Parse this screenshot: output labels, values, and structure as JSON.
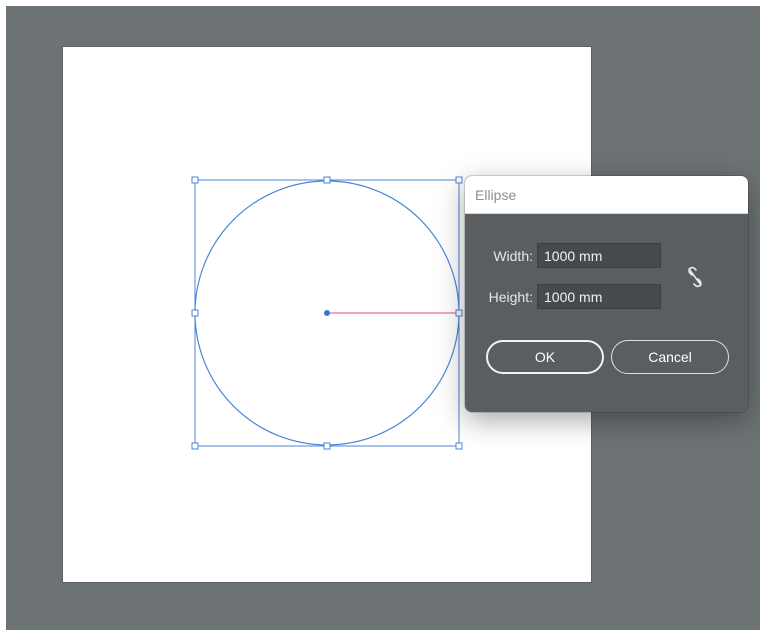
{
  "dialog": {
    "title": "Ellipse",
    "width_label": "Width:",
    "width_value": "1000 mm",
    "height_label": "Height:",
    "height_value": "1000 mm",
    "ok_label": "OK",
    "cancel_label": "Cancel",
    "constrain_icon": "broken-link-icon"
  },
  "colors": {
    "workspace": "#6d7275",
    "artboard": "#ffffff",
    "selection": "#4a86d8",
    "radius_guide": "#e889b0",
    "dialog_bg": "#5a5e61"
  }
}
